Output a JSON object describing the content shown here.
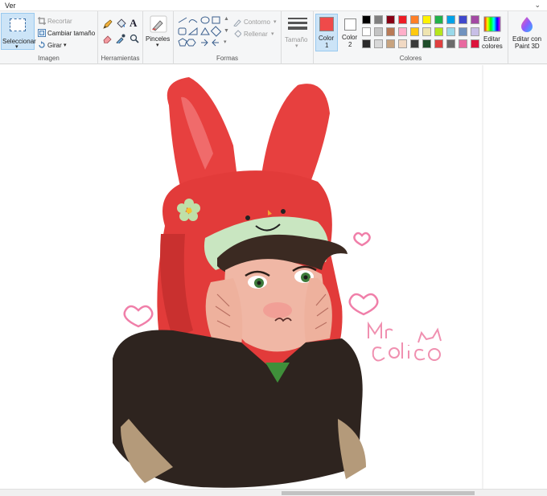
{
  "menu": {
    "ver_label": "Ver"
  },
  "groups": {
    "imagen": {
      "label": "Imagen",
      "select_label": "Seleccionar",
      "crop_label": "Recortar",
      "resize_label": "Cambiar tamaño",
      "rotate_label": "Girar"
    },
    "herramientas": {
      "label": "Herramientas"
    },
    "pinceles": {
      "label": "Pinceles"
    },
    "formas": {
      "label": "Formas",
      "outline_label": "Contorno",
      "fill_label": "Rellenar"
    },
    "tamano": {
      "label": "Tamaño"
    },
    "colores": {
      "label": "Colores",
      "color1_label": "Color",
      "color1_num": "1",
      "color2_label": "Color",
      "color2_num": "2",
      "edit_label_1": "Editar",
      "edit_label_2": "colores",
      "color1": "#ef4a4a",
      "color2": "#ffffff",
      "palette_row1": [
        "#000000",
        "#7f7f7f",
        "#880015",
        "#ed1c24",
        "#ff7f27",
        "#fff200",
        "#22b14c",
        "#00a2e8",
        "#3f48cc",
        "#a349a4"
      ],
      "palette_row2": [
        "#ffffff",
        "#c3c3c3",
        "#b97a57",
        "#ffaec9",
        "#ffc90e",
        "#efe4b0",
        "#b5e61d",
        "#99d9ea",
        "#7092be",
        "#c8bfe7"
      ],
      "palette_row3": [
        "#2b2b2b",
        "#d8d8d8",
        "#c7a37f",
        "#f1d9c3",
        "#3a3a3a",
        "#1f4d2a",
        "#e04040",
        "#6b6b6b",
        "#e86aa0",
        "#dc143c"
      ]
    },
    "paint3d": {
      "label_1": "Editar con",
      "label_2": "Paint 3D"
    }
  },
  "drawing": {
    "signature": "Mr. Colico"
  }
}
